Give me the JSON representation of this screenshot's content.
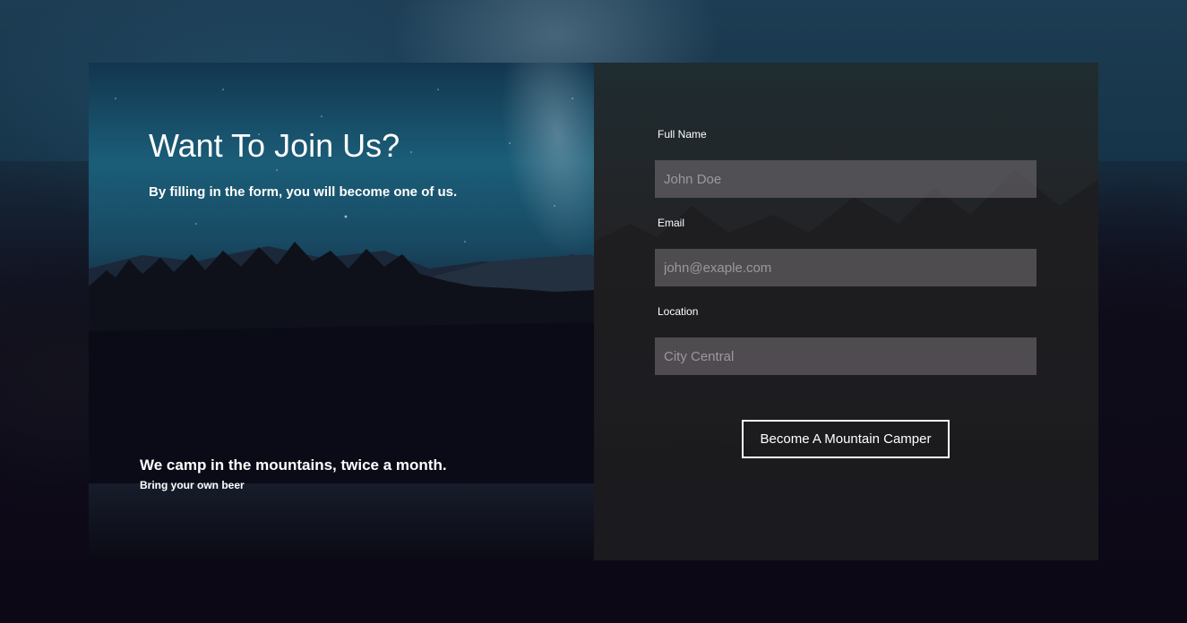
{
  "hero": {
    "heading": "Want To Join Us?",
    "subheading": "By filling in the form, you will become one of us.",
    "tagline": "We camp in the mountains, twice a month.",
    "tagline_sub": "Bring your own beer"
  },
  "form": {
    "full_name": {
      "label": "Full Name",
      "placeholder": "John Doe",
      "value": ""
    },
    "email": {
      "label": "Email",
      "placeholder": "john@exaple.com",
      "value": ""
    },
    "location": {
      "label": "Location",
      "placeholder": "City Central",
      "value": ""
    },
    "submit_label": "Become A Mountain Camper"
  },
  "colors": {
    "text": "#ffffff",
    "input_bg": "#6f6b6f",
    "panel_dark": "#222125"
  }
}
